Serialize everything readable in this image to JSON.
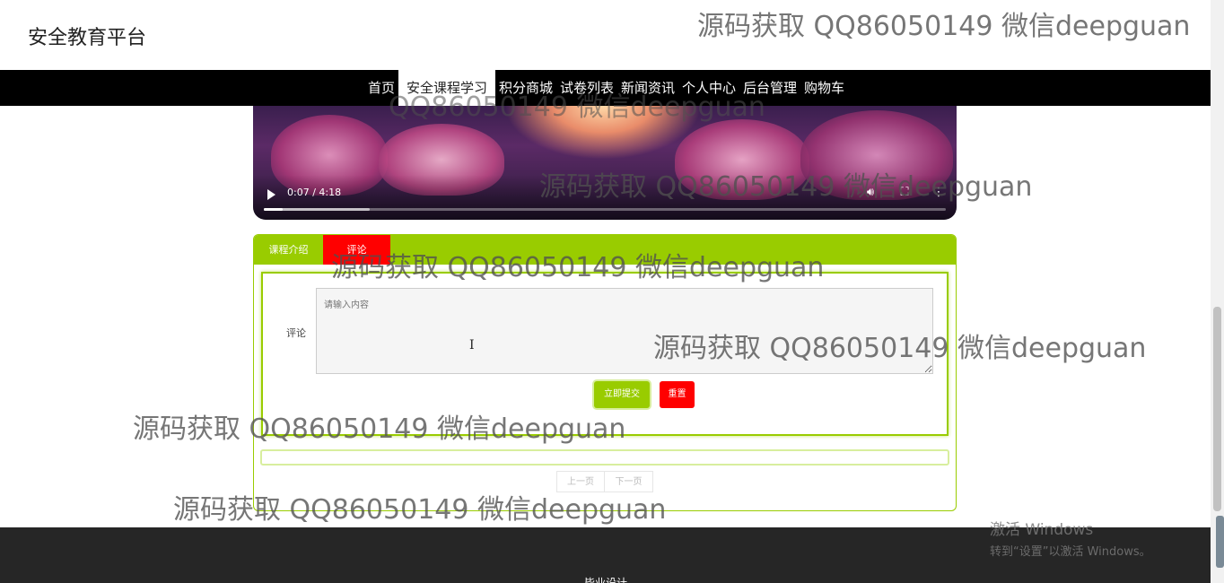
{
  "header": {
    "site_title": "安全教育平台"
  },
  "nav": {
    "items": [
      {
        "label": "首页"
      },
      {
        "label": "安全课程学习",
        "active": true
      },
      {
        "label": "积分商城"
      },
      {
        "label": "试卷列表"
      },
      {
        "label": "新闻资讯"
      },
      {
        "label": "个人中心"
      },
      {
        "label": "后台管理"
      },
      {
        "label": "购物车"
      }
    ]
  },
  "video": {
    "time": "0:07 / 4:18",
    "played_fraction": 0.028,
    "buffered_fraction": 0.155,
    "icons": [
      "play-icon",
      "volume-icon",
      "fullscreen-icon",
      "more-icon"
    ]
  },
  "course_panel": {
    "tabs": [
      {
        "label": "课程介绍"
      },
      {
        "label": "评论",
        "active": true
      }
    ],
    "comment": {
      "label": "评论",
      "placeholder": "请输入内容",
      "submit_label": "立即提交",
      "reset_label": "重置"
    },
    "pager": {
      "prev_label": "上一页",
      "next_label": "下一页"
    }
  },
  "watermarks": [
    "源码获取 QQ86050149 微信deepguan",
    "QQ86050149 微信deepguan",
    "源码获取 QQ86050149 微信deepguan",
    "源码获取 QQ86050149 微信deepguan",
    "源码获取 QQ86050149 微信deepguan",
    "源码获取 QQ86050149 微信deepguan",
    "源码获取 QQ86050149 微信deepguan"
  ],
  "footer": {
    "text": "毕业设计"
  },
  "os_overlay": {
    "line1": "激活 Windows",
    "line2": "转到“设置”以激活 Windows。"
  },
  "colors": {
    "accent": "#99cc00",
    "danger": "#ff0000",
    "nav_bg": "#000000",
    "footer_bg": "#262626"
  }
}
